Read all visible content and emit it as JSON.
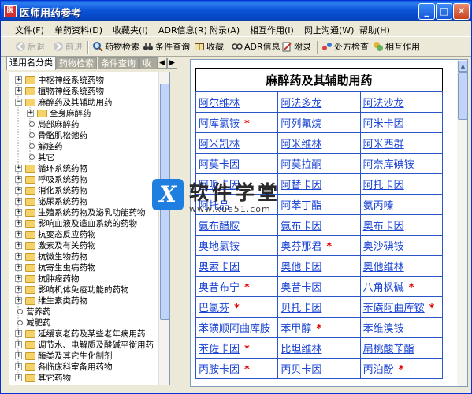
{
  "window": {
    "title": "医师用药参考"
  },
  "menu": [
    "文件(F)",
    "单药资料(D)",
    "收藏夹(I)",
    "ADR信息(R)",
    "附录(A)",
    "相互作用(I)",
    "网上沟通(W)",
    "帮助(H)"
  ],
  "toolbar": {
    "back": "后退",
    "forward": "前进",
    "drug_search": "药物检索",
    "condition_query": "条件查询",
    "favorites": "收藏",
    "adr_info": "ADR信息",
    "appendix": "附录",
    "prescription_check": "处方检查",
    "interactions": "相互作用"
  },
  "tabs": [
    "通用名分类",
    "药物检索",
    "条件查询",
    "收藏"
  ],
  "tree": [
    {
      "label": "中枢神经系统药物",
      "level": 0,
      "kind": "folder",
      "state": "+"
    },
    {
      "label": "植物神经系统药物",
      "level": 0,
      "kind": "folder",
      "state": "+"
    },
    {
      "label": "麻醉药及其辅助用药",
      "level": 0,
      "kind": "folder",
      "state": "-"
    },
    {
      "label": "全身麻醉药",
      "level": 1,
      "kind": "folder",
      "state": "+"
    },
    {
      "label": "局部麻醉药",
      "level": 1,
      "kind": "leaf"
    },
    {
      "label": "骨骼肌松弛药",
      "level": 1,
      "kind": "leaf"
    },
    {
      "label": "解痉药",
      "level": 1,
      "kind": "leaf"
    },
    {
      "label": "其它",
      "level": 1,
      "kind": "leaf"
    },
    {
      "label": "循环系统药物",
      "level": 0,
      "kind": "folder",
      "state": "+"
    },
    {
      "label": "呼吸系统药物",
      "level": 0,
      "kind": "folder",
      "state": "+"
    },
    {
      "label": "消化系统药物",
      "level": 0,
      "kind": "folder",
      "state": "+"
    },
    {
      "label": "泌尿系统药物",
      "level": 0,
      "kind": "folder",
      "state": "+"
    },
    {
      "label": "生殖系统药物及泌乳功能药物",
      "level": 0,
      "kind": "folder",
      "state": "+"
    },
    {
      "label": "影响血液及造血系统的药物",
      "level": 0,
      "kind": "folder",
      "state": "+"
    },
    {
      "label": "抗变态反应药物",
      "level": 0,
      "kind": "folder",
      "state": "+"
    },
    {
      "label": "激素及有关药物",
      "level": 0,
      "kind": "folder",
      "state": "+"
    },
    {
      "label": "抗微生物药物",
      "level": 0,
      "kind": "folder",
      "state": "+"
    },
    {
      "label": "抗寄生虫病药物",
      "level": 0,
      "kind": "folder",
      "state": "+"
    },
    {
      "label": "抗肿瘤药物",
      "level": 0,
      "kind": "folder",
      "state": "+"
    },
    {
      "label": "影响机体免疫功能的药物",
      "level": 0,
      "kind": "folder",
      "state": "+"
    },
    {
      "label": "维生素类药物",
      "level": 0,
      "kind": "folder",
      "state": "+"
    },
    {
      "label": "营养药",
      "level": 0,
      "kind": "leaf"
    },
    {
      "label": "减肥药",
      "level": 0,
      "kind": "leaf"
    },
    {
      "label": "延缓衰老药及某些老年病用药",
      "level": 0,
      "kind": "folder",
      "state": "+"
    },
    {
      "label": "调节水、电解质及酸碱平衡用药",
      "level": 0,
      "kind": "folder",
      "state": "+"
    },
    {
      "label": "酶类及其它生化制剂",
      "level": 0,
      "kind": "folder",
      "state": "+"
    },
    {
      "label": "各临床科室备用药物",
      "level": 0,
      "kind": "folder",
      "state": "+"
    },
    {
      "label": "其它药物",
      "level": 0,
      "kind": "folder",
      "state": "+"
    }
  ],
  "content": {
    "title": "麻醉药及其辅助用药",
    "rows": [
      [
        {
          "name": "阿尔维林",
          "star": false
        },
        {
          "name": "阿法多龙",
          "star": false
        },
        {
          "name": "阿法沙龙",
          "star": false
        }
      ],
      [
        {
          "name": "阿库氯铵",
          "star": true
        },
        {
          "name": "阿列氟烷",
          "star": false
        },
        {
          "name": "阿米卡因",
          "star": false
        }
      ],
      [
        {
          "name": "阿米凯林",
          "star": false
        },
        {
          "name": "阿米维林",
          "star": false
        },
        {
          "name": "阿米西群",
          "star": false
        }
      ],
      [
        {
          "name": "阿莫卡因",
          "star": false
        },
        {
          "name": "阿莫拉酮",
          "star": false
        },
        {
          "name": "阿奈库碘铵",
          "star": false
        }
      ],
      [
        {
          "name": "阿哌卡因",
          "star": false
        },
        {
          "name": "阿替卡因",
          "star": false
        },
        {
          "name": "阿托卡因",
          "star": false
        }
      ],
      [
        {
          "name": "阿托品",
          "star": false
        },
        {
          "name": "阿苯丁酯",
          "star": false
        },
        {
          "name": "氨丙嗪",
          "star": false
        }
      ],
      [
        {
          "name": "氨布醋胺",
          "star": false
        },
        {
          "name": "氨布卡因",
          "star": false
        },
        {
          "name": "奥布卡因",
          "star": false
        }
      ],
      [
        {
          "name": "奥地氯铵",
          "star": false
        },
        {
          "name": "奥芬那君",
          "star": true
        },
        {
          "name": "奥沙碘铵",
          "star": false
        }
      ],
      [
        {
          "name": "奥索卡因",
          "star": false
        },
        {
          "name": "奥他卡因",
          "star": false
        },
        {
          "name": "奥他维林",
          "star": false
        }
      ],
      [
        {
          "name": "奥昔布宁",
          "star": true
        },
        {
          "name": "奥昔卡因",
          "star": false
        },
        {
          "name": "八角枫碱",
          "star": true
        }
      ],
      [
        {
          "name": "巴氯芬",
          "star": true
        },
        {
          "name": "贝托卡因",
          "star": false
        },
        {
          "name": "苯磺阿曲库铵",
          "star": true
        }
      ],
      [
        {
          "name": "苯磺顺阿曲库胺",
          "star": false
        },
        {
          "name": "苯甲醇",
          "star": true
        },
        {
          "name": "苯维溴铵",
          "star": false
        }
      ],
      [
        {
          "name": "苯佐卡因",
          "star": true
        },
        {
          "name": "比坦维林",
          "star": false
        },
        {
          "name": "扁桃酸苄酯",
          "star": false
        }
      ],
      [
        {
          "name": "丙胺卡因",
          "star": true
        },
        {
          "name": "丙贝卡因",
          "star": false
        },
        {
          "name": "丙泊酚",
          "star": true
        }
      ]
    ]
  },
  "watermark": {
    "name": "软件学堂",
    "url": "www.xue51.com"
  },
  "colors": {
    "link": "#1a44d4",
    "star": "#e00000",
    "title_bar": "#0a55d8",
    "grid_border": "#2a55c6"
  }
}
